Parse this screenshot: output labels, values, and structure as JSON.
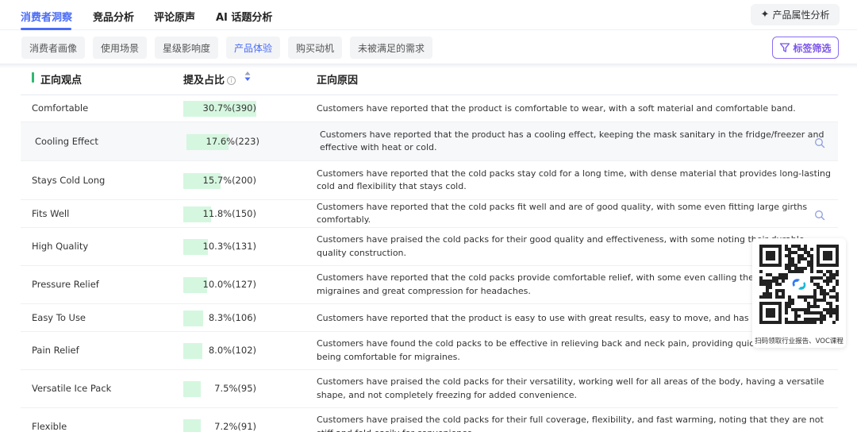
{
  "top_tabs": [
    {
      "label": "消费者洞察",
      "active": true
    },
    {
      "label": "竞品分析"
    },
    {
      "label": "评论原声"
    },
    {
      "label": "AI 话题分析"
    }
  ],
  "attribute_button": {
    "label": "产品属性分析",
    "icon": "sparkle-icon"
  },
  "sub_tabs": [
    {
      "label": "消费者画像"
    },
    {
      "label": "使用场景"
    },
    {
      "label": "星级影响度"
    },
    {
      "label": "产品体验",
      "active": true
    },
    {
      "label": "购买动机"
    },
    {
      "label": "未被满足的需求"
    }
  ],
  "filter_button": {
    "label": "标签筛选",
    "icon": "funnel-icon"
  },
  "table": {
    "headers": {
      "viewpoint": "正向观点",
      "share": "提及占比",
      "reason": "正向原因"
    },
    "accent_color": "#2fb870",
    "bar_color": "#d5f7df",
    "rows": [
      {
        "name": "Comfortable",
        "share": 0.307,
        "pct": "30.7%(390)",
        "reason": "Customers have reported that the product is comfortable to wear, with a soft material and comfortable band."
      },
      {
        "name": "Cooling Effect",
        "share": 0.176,
        "pct": "17.6%(223)",
        "reason": "Customers have reported that the product has a cooling effect, keeping the mask sanitary in the fridge/freezer and effective with heat or cold."
      },
      {
        "name": "Stays Cold Long",
        "share": 0.157,
        "pct": "15.7%(200)",
        "reason": "Customers have reported that the cold packs stay cold for a long time, with dense material that provides long-lasting cold and flexibility that stays cold."
      },
      {
        "name": "Fits Well",
        "share": 0.118,
        "pct": "11.8%(150)",
        "reason": "Customers have reported that the cold packs fit well and are of good quality, with some even fitting large girths comfortably."
      },
      {
        "name": "High Quality",
        "share": 0.103,
        "pct": "10.3%(131)",
        "reason": "Customers have praised the cold packs for their good quality and effectiveness, with some noting their durable, quality construction."
      },
      {
        "name": "Pressure Relief",
        "share": 0.1,
        "pct": "10.0%(127)",
        "reason": "Customers have reported that the cold packs provide comfortable relief, with some even calling them fantastic for migraines and great compression for headaches."
      },
      {
        "name": "Easy To Use",
        "share": 0.083,
        "pct": "8.3%(106)",
        "reason": "Customers have reported that the product is easy to use with great results, easy to move, and has noticeable results."
      },
      {
        "name": "Pain Relief",
        "share": 0.08,
        "pct": "8.0%(102)",
        "reason": "Customers have found the cold packs to be effective in relieving back and neck pain, providing quick pain relief, and being comfortable for migraines."
      },
      {
        "name": "Versatile Ice Pack",
        "share": 0.075,
        "pct": "7.5%(95)",
        "reason": "Customers have praised the cold packs for their versatility, working well for all areas of the body, having a versatile shape, and not completely freezing for added convenience."
      },
      {
        "name": "Flexible",
        "share": 0.072,
        "pct": "7.2%(91)",
        "reason": "Customers have praised the cold packs for their full coverage, flexibility, and fast warming, noting that they are not stiff and fold easily for convenience."
      }
    ]
  },
  "qr_popup": {
    "caption": "扫码领取行业报告、VOC课程",
    "icon": "qr-code-icon"
  }
}
